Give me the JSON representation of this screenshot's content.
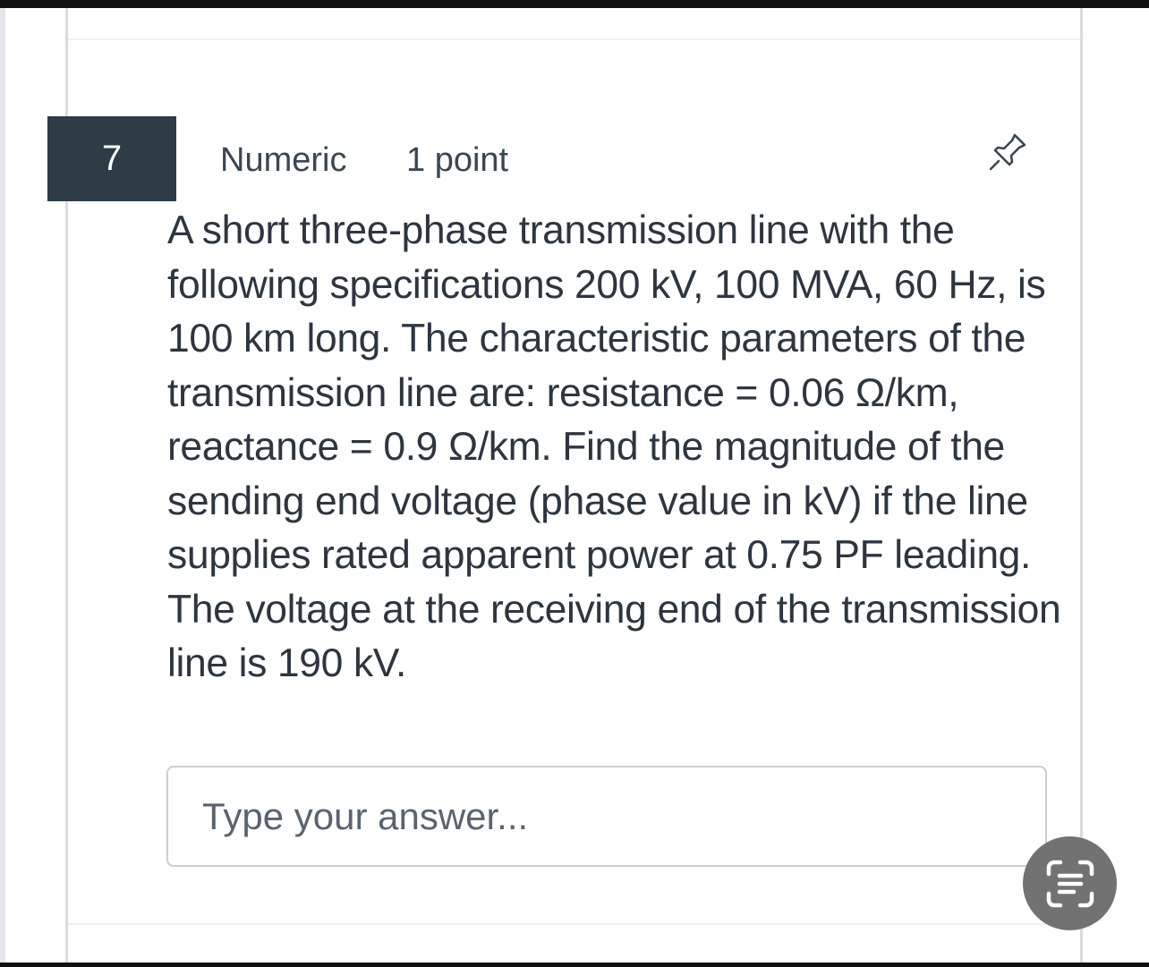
{
  "question": {
    "number": "7",
    "type": "Numeric",
    "points": "1 point",
    "text": "A short three-phase transmission line with the following specifications 200 kV, 100 MVA, 60 Hz, is 100 km long. The characteristic parameters of the transmission line are: resistance = 0.06 Ω/km, reactance = 0.9 Ω/km. Find the magnitude of the sending end voltage (phase value in kV) if the line supplies rated apparent power at 0.75 PF leading. The voltage at the receiving end of the transmission line is 190 kV."
  },
  "answer": {
    "placeholder": "Type your answer...",
    "value": ""
  },
  "icons": {
    "pin": "pin-icon",
    "lens": "text-scan-icon"
  },
  "colors": {
    "question_badge": "#2f3b45",
    "text": "#2d3640",
    "lens_button": "#727272"
  }
}
